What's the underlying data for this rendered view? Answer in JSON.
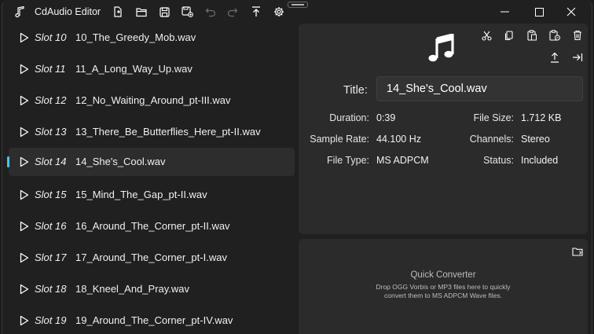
{
  "app": {
    "title": "CdAudio Editor"
  },
  "slots": [
    {
      "slot": "Slot 10",
      "file": "10_The_Greedy_Mob.wav"
    },
    {
      "slot": "Slot 11",
      "file": "11_A_Long_Way_Up.wav"
    },
    {
      "slot": "Slot 12",
      "file": "12_No_Waiting_Around_pt-III.wav"
    },
    {
      "slot": "Slot 13",
      "file": "13_There_Be_Butterflies_Here_pt-II.wav"
    },
    {
      "slot": "Slot 14",
      "file": "14_She's_Cool.wav"
    },
    {
      "slot": "Slot 15",
      "file": "15_Mind_The_Gap_pt-II.wav"
    },
    {
      "slot": "Slot 16",
      "file": "16_Around_The_Corner_pt-II.wav"
    },
    {
      "slot": "Slot 17",
      "file": "17_Around_The_Corner_pt-I.wav"
    },
    {
      "slot": "Slot 18",
      "file": "18_Kneel_And_Pray.wav"
    },
    {
      "slot": "Slot 19",
      "file": "19_Around_The_Corner_pt-IV.wav"
    }
  ],
  "details": {
    "title_label": "Title:",
    "title_value": "14_She's_Cool.wav",
    "duration_label": "Duration:",
    "duration_value": "0:39",
    "filesize_label": "File Size:",
    "filesize_value": "1.712 KB",
    "samplerate_label": "Sample Rate:",
    "samplerate_value": "44.100 Hz",
    "channels_label": "Channels:",
    "channels_value": "Stereo",
    "filetype_label": "File Type:",
    "filetype_value": "MS ADPCM",
    "status_label": "Status:",
    "status_value": "Included"
  },
  "converter": {
    "title": "Quick Converter",
    "description": "Drop OGG Vorbis or MP3 files here to quickly convert them to MS ADPCM Wave files."
  },
  "colors": {
    "accent": "#4cc2ff",
    "background": "#202020",
    "panel": "#2b2b2b",
    "selected_row": "#2d2d2d"
  },
  "icons": {
    "titlebar": [
      "music-note-icon",
      "new-file-icon",
      "open-folder-icon",
      "save-icon",
      "save-as-icon",
      "undo-icon",
      "redo-icon",
      "export-icon",
      "settings-icon"
    ],
    "panel": [
      "cut-icon",
      "copy-icon",
      "paste-icon",
      "paste-special-icon",
      "delete-icon",
      "upload-icon",
      "move-to-end-icon"
    ]
  }
}
